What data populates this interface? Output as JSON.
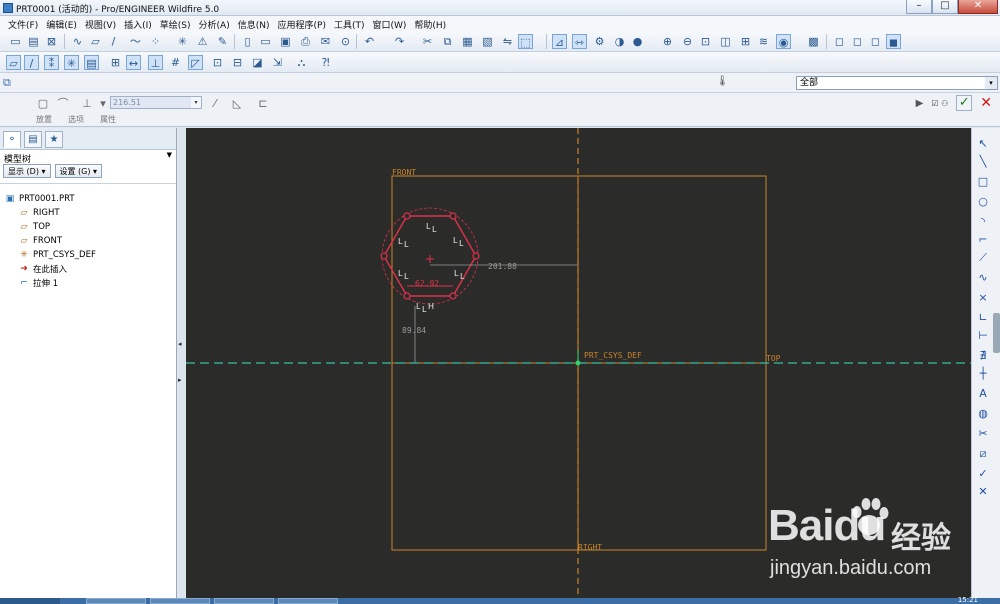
{
  "window": {
    "title": "PRT0001 (活动的) - Pro/ENGINEER Wildfire 5.0",
    "controls": [
      "–",
      "□",
      "✕"
    ]
  },
  "menu": [
    "文件(F)",
    "编辑(E)",
    "视图(V)",
    "插入(I)",
    "草绘(S)",
    "分析(A)",
    "信息(N)",
    "应用程序(P)",
    "工具(T)",
    "窗口(W)",
    "帮助(H)"
  ],
  "filter": {
    "value": "全部"
  },
  "dashboard": {
    "depth_value": "216.51",
    "tabs": [
      "放置",
      "选项",
      "属性"
    ]
  },
  "model_tree": {
    "title": "模型树",
    "show_button": "显示 (D) ▾",
    "settings_button": "设置 (G) ▾",
    "items": [
      {
        "label": "PRT0001.PRT",
        "icon": "part-icon",
        "child": false
      },
      {
        "label": "RIGHT",
        "icon": "datum-plane-icon",
        "child": true
      },
      {
        "label": "TOP",
        "icon": "datum-plane-icon",
        "child": true
      },
      {
        "label": "FRONT",
        "icon": "datum-plane-icon",
        "child": true
      },
      {
        "label": "PRT_CSYS_DEF",
        "icon": "csys-icon",
        "child": true
      },
      {
        "label": "在此插入",
        "icon": "insert-here-arrow-icon",
        "child": true
      },
      {
        "label": "拉伸 1",
        "icon": "extrude-icon",
        "child": true
      }
    ]
  },
  "sketch": {
    "plane_labels": {
      "front": "FRONT",
      "top": "TOP",
      "right": "RIGHT",
      "csys": "PRT_CSYS_DEF"
    },
    "dimensions": {
      "horizontal": "201.88",
      "vertical": "89.84",
      "width": "62.92"
    },
    "constraints": {
      "L": "L",
      "H": "H"
    }
  },
  "colors": {
    "graphics_bg": "#2b2b2a",
    "datum_plane": "#c8842a",
    "sketch_geometry": "#e0304a",
    "dimension": "#9a9a9a",
    "centerline": "#35c0a0"
  },
  "taskbar": {
    "clock": "15:21"
  },
  "watermark": {
    "brand": "Baidu",
    "cn": "经验",
    "url": "jingyan.baidu.com"
  }
}
